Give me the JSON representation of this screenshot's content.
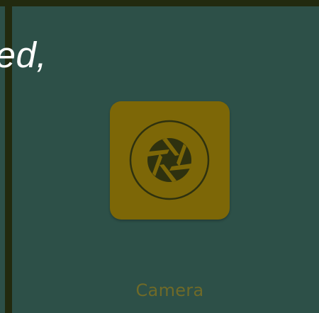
{
  "overlay": {
    "caption": "lled,"
  },
  "app": {
    "label": "Camera",
    "icon": "aperture-icon",
    "tile_color": "#7d6707",
    "label_color": "#6f6a28"
  },
  "colors": {
    "background": "#2d5048",
    "frame": "#222a0f",
    "icon_ink": "#2e310f"
  }
}
